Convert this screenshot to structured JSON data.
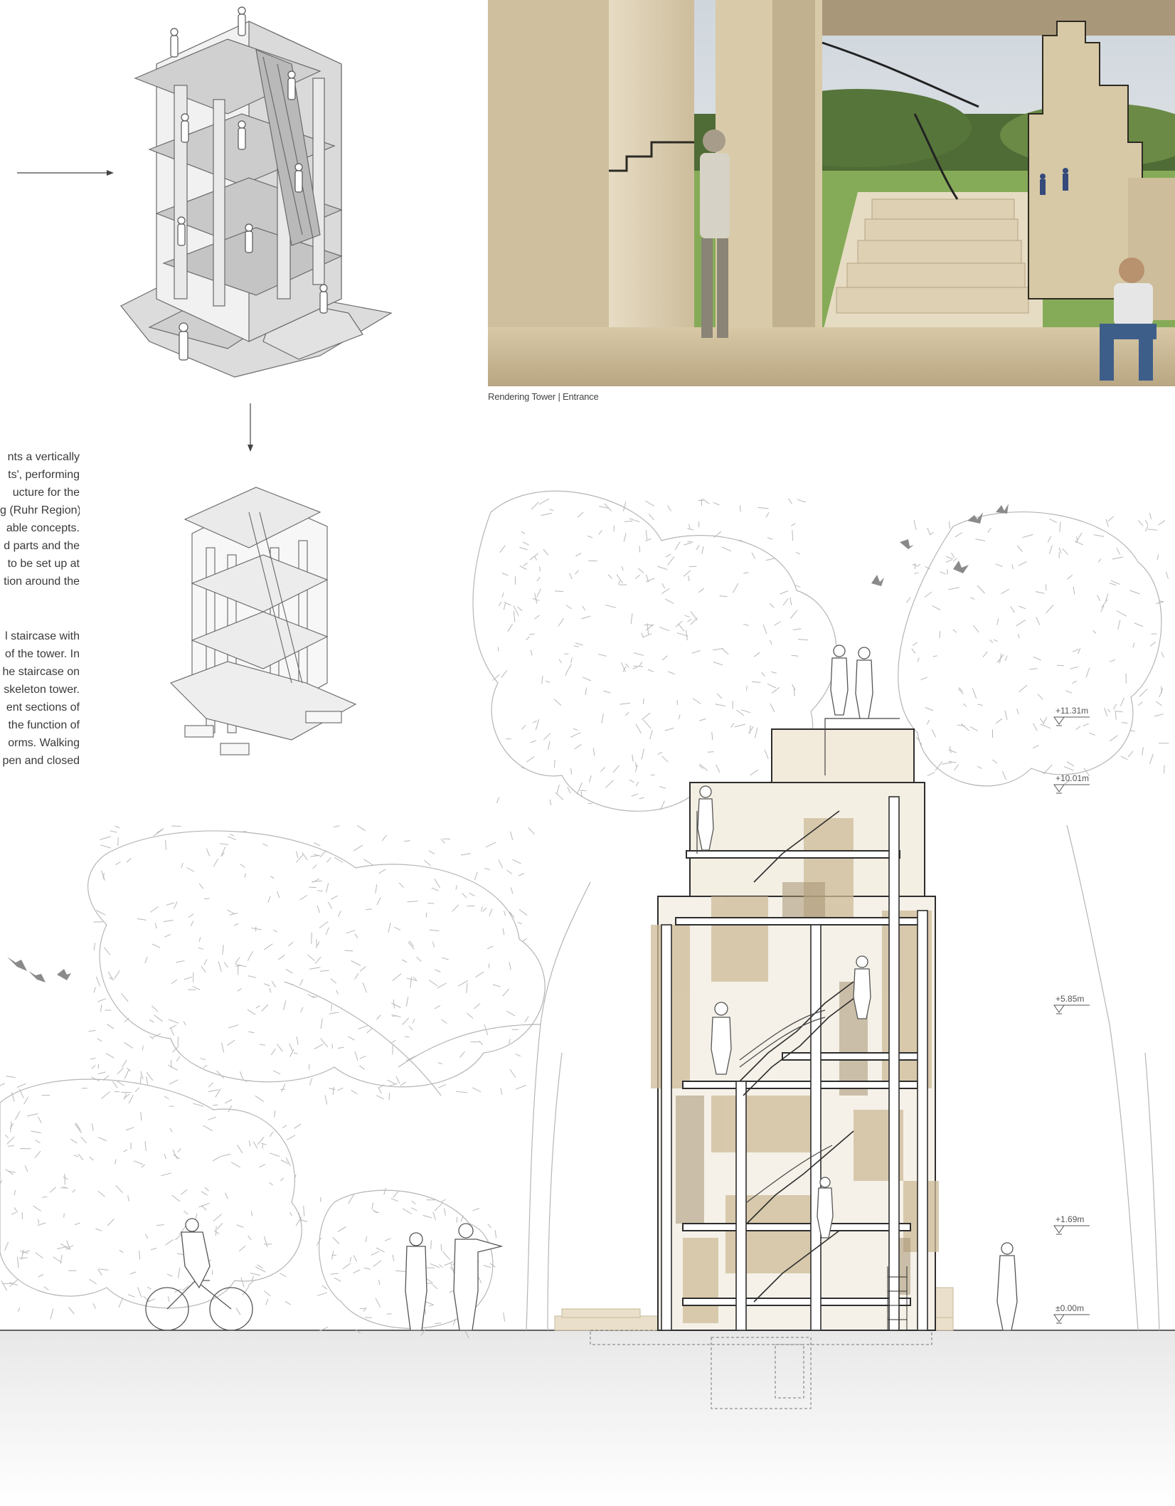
{
  "caption": "Rendering Tower | Entrance",
  "text_paragraphs": [
    [
      "nts a vertically",
      "ts', performing",
      "ucture for the",
      "g (Ruhr Region)",
      "able concepts.",
      "d parts and the",
      "to be set up at",
      "tion around the"
    ],
    [
      "l staircase with",
      "of the tower. In",
      "he staircase on",
      "skeleton tower.",
      "ent sections of",
      "the function of",
      "orms. Walking",
      "pen and closed"
    ]
  ],
  "levels": [
    {
      "id": "l1131",
      "label": "+11.31m",
      "top": 0
    },
    {
      "id": "l1001",
      "label": "+10.01m",
      "top": 0
    },
    {
      "id": "l585",
      "label": "+5.85m",
      "top": 0
    },
    {
      "id": "l169",
      "label": "+1.69m",
      "top": 0
    },
    {
      "id": "l000",
      "label": "±0.00m",
      "top": 0
    }
  ],
  "colors": {
    "wood": "#d9cbb0",
    "wood_dark": "#a89676",
    "wood_shadow": "#8c7c60",
    "sky": "#dfe5ea",
    "grass": "#7fa352",
    "line": "#555555",
    "tree_line": "#9a9a9a",
    "ground": "#efefef"
  }
}
